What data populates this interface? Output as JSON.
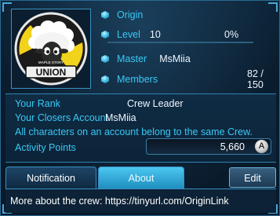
{
  "crew": {
    "name": "Origin",
    "level_label": "Level",
    "level_value": "10",
    "xp_percent_text": "0%",
    "xp_progress": 0,
    "master_label": "Master",
    "master_value": "MsMiia",
    "members_label": "Members",
    "members_value": "82 / 150",
    "emblem_text": "UNION",
    "emblem_subtext": "MAPLE STORY"
  },
  "details": {
    "rank_label": "Your Rank",
    "rank_value": "Crew Leader",
    "account_label": "Your Closers Account",
    "account_value": "MsMiia",
    "notice": "All characters on an account belong to the same Crew.",
    "activity_label": "Activity Points",
    "activity_value": "5,660",
    "activity_button_glyph": "A"
  },
  "tabs": [
    {
      "label": "Notification",
      "active": false
    },
    {
      "label": "About",
      "active": true
    }
  ],
  "edit_label": "Edit",
  "about_text": "More about the crew: https://tinyurl.com/OriginLink",
  "colors": {
    "accent": "#39c8f4",
    "panel_bg": "#0d2438",
    "active_tab": "#2fa7d8"
  }
}
